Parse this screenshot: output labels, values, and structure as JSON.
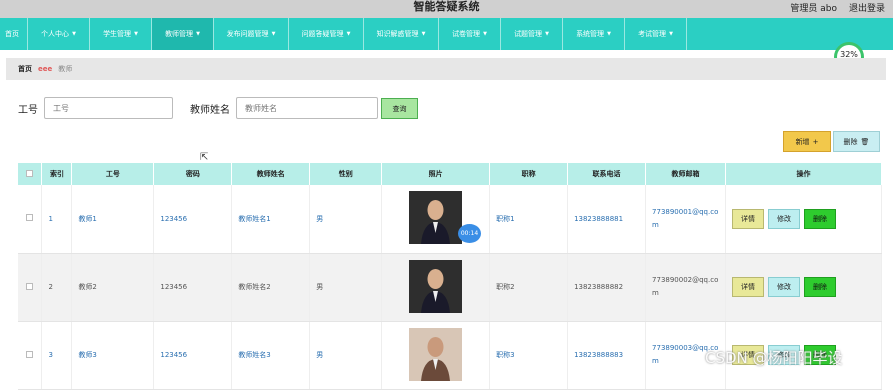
{
  "header": {
    "title": "智能答疑系统",
    "user": "管理员 abo",
    "logout": "退出登录"
  },
  "nav": [
    {
      "label": "首页",
      "caret": false
    },
    {
      "label": "个人中心",
      "caret": true
    },
    {
      "label": "学生管理",
      "caret": true
    },
    {
      "label": "教师管理",
      "caret": true,
      "active": true
    },
    {
      "label": "发布问题管理",
      "caret": true
    },
    {
      "label": "问题答疑管理",
      "caret": true
    },
    {
      "label": "知识解惑管理",
      "caret": true
    },
    {
      "label": "试卷管理",
      "caret": true
    },
    {
      "label": "试题管理",
      "caret": true
    },
    {
      "label": "系统管理",
      "caret": true
    },
    {
      "label": "考试管理",
      "caret": true
    }
  ],
  "badge": {
    "percent": "32%",
    "sub": "↓ 0K/S"
  },
  "breadcrumb": {
    "home": "首页",
    "sep": "ееe",
    "current": "教师"
  },
  "search": {
    "label_id": "工号",
    "placeholder_id": "工号",
    "label_name": "教师姓名",
    "placeholder_name": "教师姓名",
    "button": "查询"
  },
  "actions": {
    "add": "新增",
    "add_icon": "+",
    "delete": "删除",
    "delete_icon": "🗑"
  },
  "table": {
    "headers": [
      "",
      "索引",
      "工号",
      "密码",
      "教师姓名",
      "性别",
      "照片",
      "职称",
      "联系电话",
      "教师邮箱",
      "操作"
    ],
    "rows": [
      {
        "index": "1",
        "id": "教师1",
        "password": "123456",
        "name": "教师姓名1",
        "gender": "男",
        "title": "职称1",
        "phone": "13823888881",
        "email": "773890001@qq.com"
      },
      {
        "index": "2",
        "id": "教师2",
        "password": "123456",
        "name": "教师姓名2",
        "gender": "男",
        "title": "职称2",
        "phone": "13823888882",
        "email": "773890002@qq.com"
      },
      {
        "index": "3",
        "id": "教师3",
        "password": "123456",
        "name": "教师姓名3",
        "gender": "男",
        "title": "职称3",
        "phone": "13823888883",
        "email": "773890003@qq.com"
      }
    ],
    "ops": {
      "detail": "详情",
      "edit": "修改",
      "delete": "删除"
    }
  },
  "overlay": {
    "timer": "00:14",
    "watermark": "CSDN @杨阳阳毕设"
  }
}
